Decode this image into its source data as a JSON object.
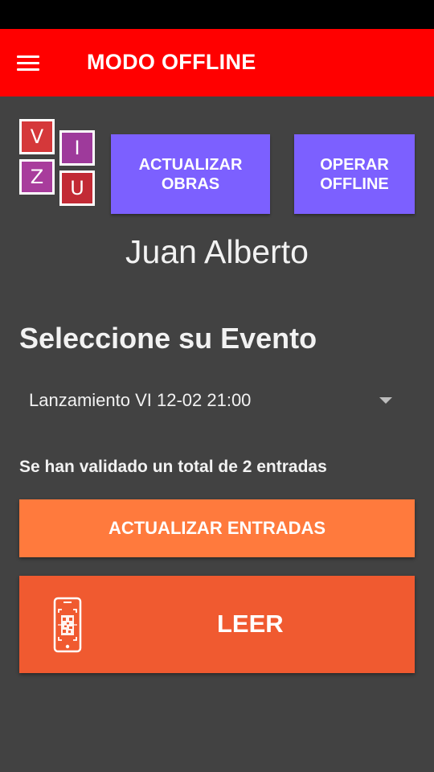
{
  "appbar": {
    "title": "MODO OFFLINE",
    "menu_icon": "hamburger-menu-icon",
    "color": "#ff0000"
  },
  "logo": {
    "tiles": [
      {
        "letter": "V",
        "color": "#d5383a"
      },
      {
        "letter": "I",
        "color": "#9e3a9b"
      },
      {
        "letter": "Z",
        "color": "#a83c9c"
      },
      {
        "letter": "U",
        "color": "#c22a35"
      }
    ]
  },
  "buttons": {
    "update_works": [
      "ACTUALIZAR",
      "OBRAS"
    ],
    "operate_offline": [
      "OPERAR",
      "OFFLINE"
    ],
    "update_tickets": "ACTUALIZAR ENTRADAS",
    "read": "LEER",
    "read_icon": "phone-qr-scan-icon"
  },
  "user": {
    "name": "Juan Alberto"
  },
  "event": {
    "section_title": "Seleccione su Evento",
    "selected": "Lanzamiento VI 12-02 21:00"
  },
  "status": {
    "validated_text": "Se han validado un total de 2 entradas"
  },
  "colors": {
    "background": "#424242",
    "purple": "#7c60ff",
    "orange": "#ff7a3d",
    "deep_orange": "#f05a30"
  }
}
